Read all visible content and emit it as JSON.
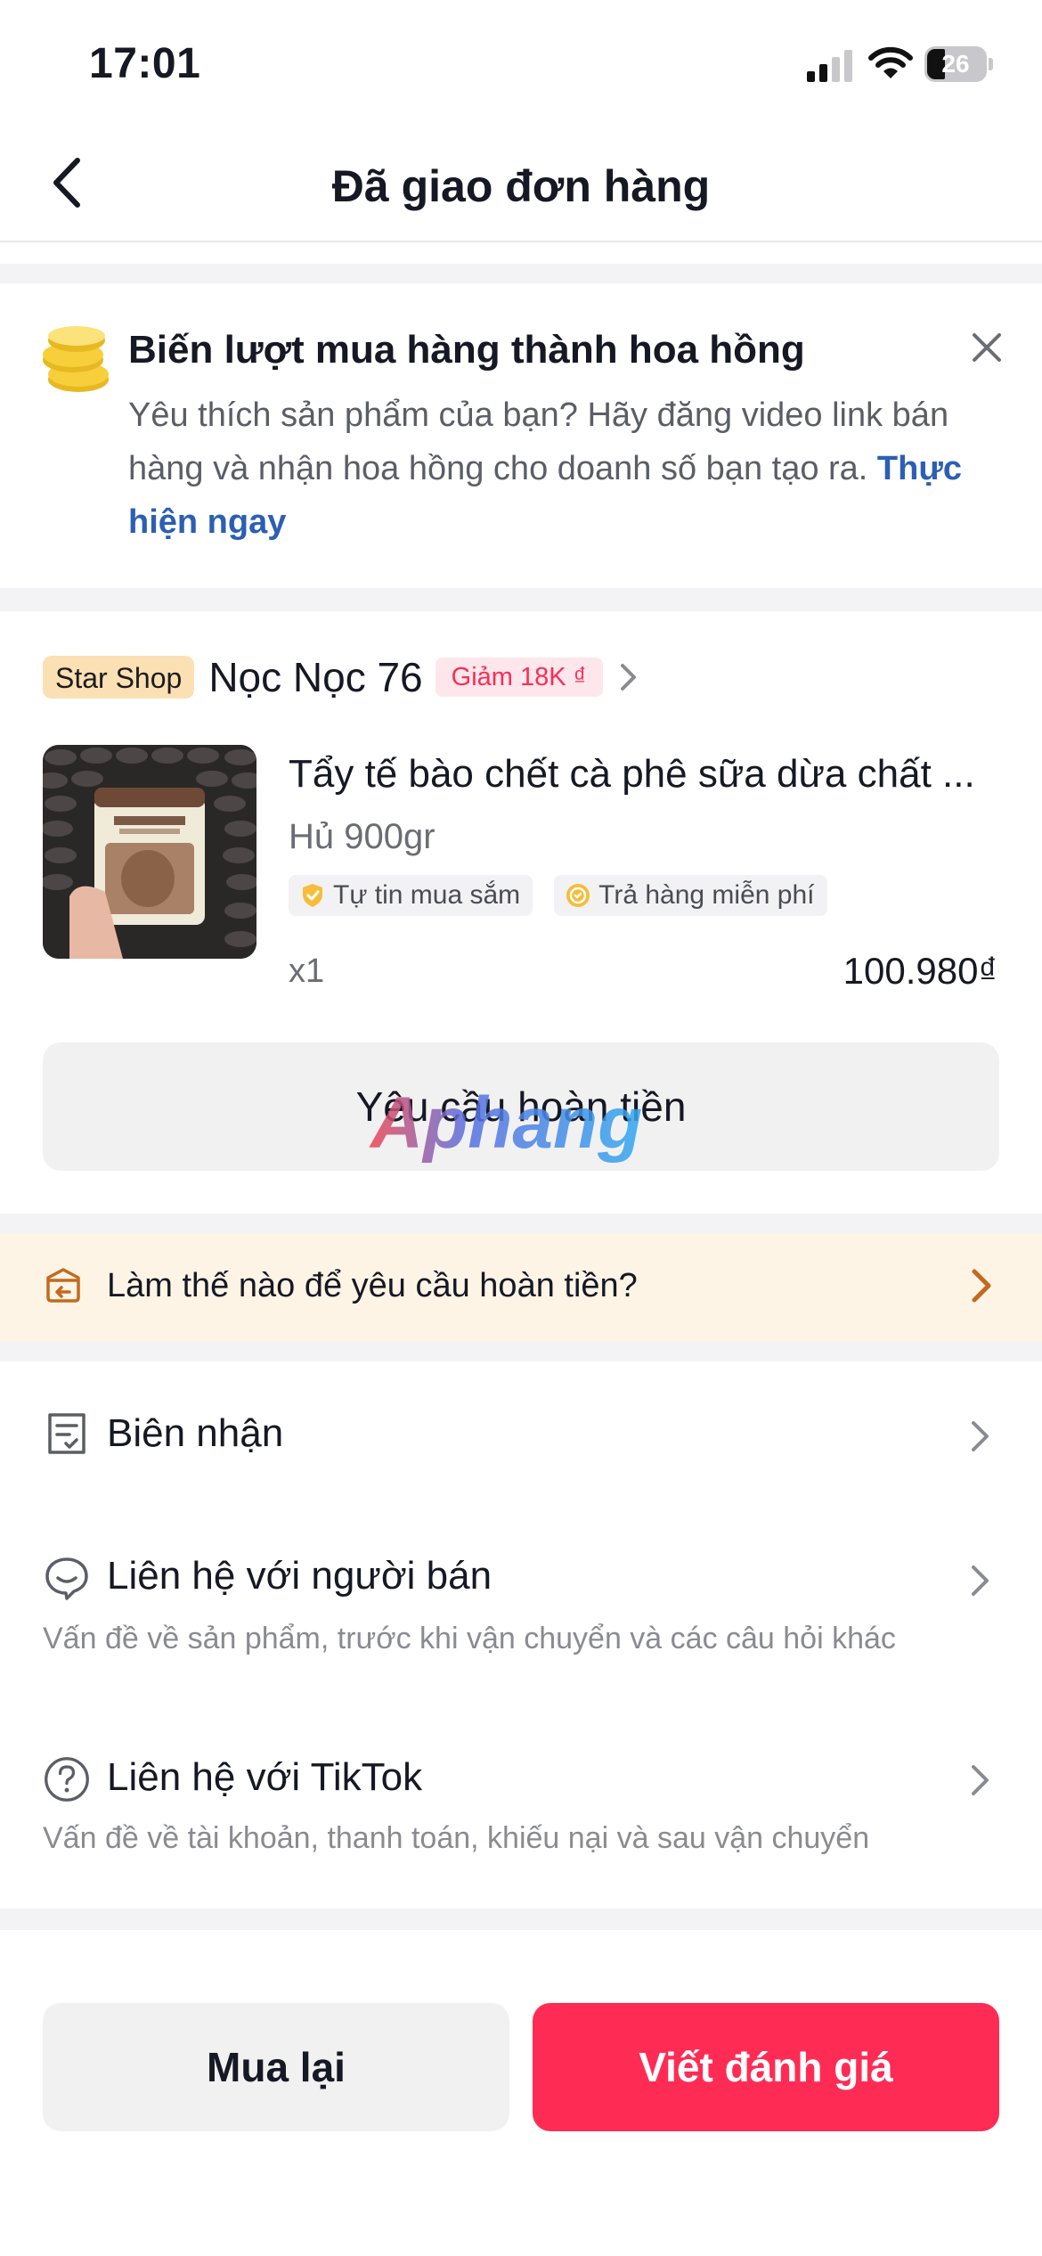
{
  "status_bar": {
    "time": "17:01",
    "battery": "26"
  },
  "header": {
    "title": "Đã giao đơn hàng"
  },
  "promo": {
    "title": "Biến lượt mua hàng thành hoa hồng",
    "body": "Yêu thích sản phẩm của bạn? Hãy đăng video link bán hàng và nhận hoa hồng cho doanh số bạn tạo ra.",
    "link": "Thực hiện ngay"
  },
  "shop": {
    "badge": "Star Shop",
    "name": "Nọc Nọc 76",
    "discount": "Giảm 18K ₫"
  },
  "product": {
    "title": "Tẩy tế bào chết cà phê sữa dừa chất ...",
    "variant": "Hủ 900gr",
    "tags": [
      "Tự tin mua sắm",
      "Trả hàng miễn phí"
    ],
    "quantity": "x1",
    "price": "100.980₫"
  },
  "refund_button": "Yêu cầu hoàn tiền",
  "watermark": "Aphang",
  "help_banner": "Làm thế nào để yêu cầu hoàn tiền?",
  "rows": {
    "receipt": {
      "title": "Biên nhận"
    },
    "contact_seller": {
      "title": "Liên hệ với người bán",
      "subtitle": "Vấn đề về sản phẩm, trước khi vận chuyển và các câu hỏi khác"
    },
    "contact_tiktok": {
      "title": "Liên hệ với TikTok",
      "subtitle": "Vấn đề về tài khoản, thanh toán, khiếu nại và sau vận chuyển"
    }
  },
  "actions": {
    "rebuy": "Mua lại",
    "review": "Viết đánh giá"
  },
  "colors": {
    "primary": "#fe2c55",
    "link": "#2b5fb4",
    "badge_star": "#fbe0b4",
    "help_bg": "#fdf4e6",
    "help_icon": "#c26a1f"
  },
  "icons": [
    "back-arrow-icon",
    "coins-icon",
    "close-icon",
    "chevron-right-icon",
    "shield-check-icon",
    "return-badge-icon",
    "box-return-icon",
    "receipt-icon",
    "chat-icon",
    "question-icon",
    "signal-icon",
    "wifi-icon",
    "battery-icon"
  ]
}
